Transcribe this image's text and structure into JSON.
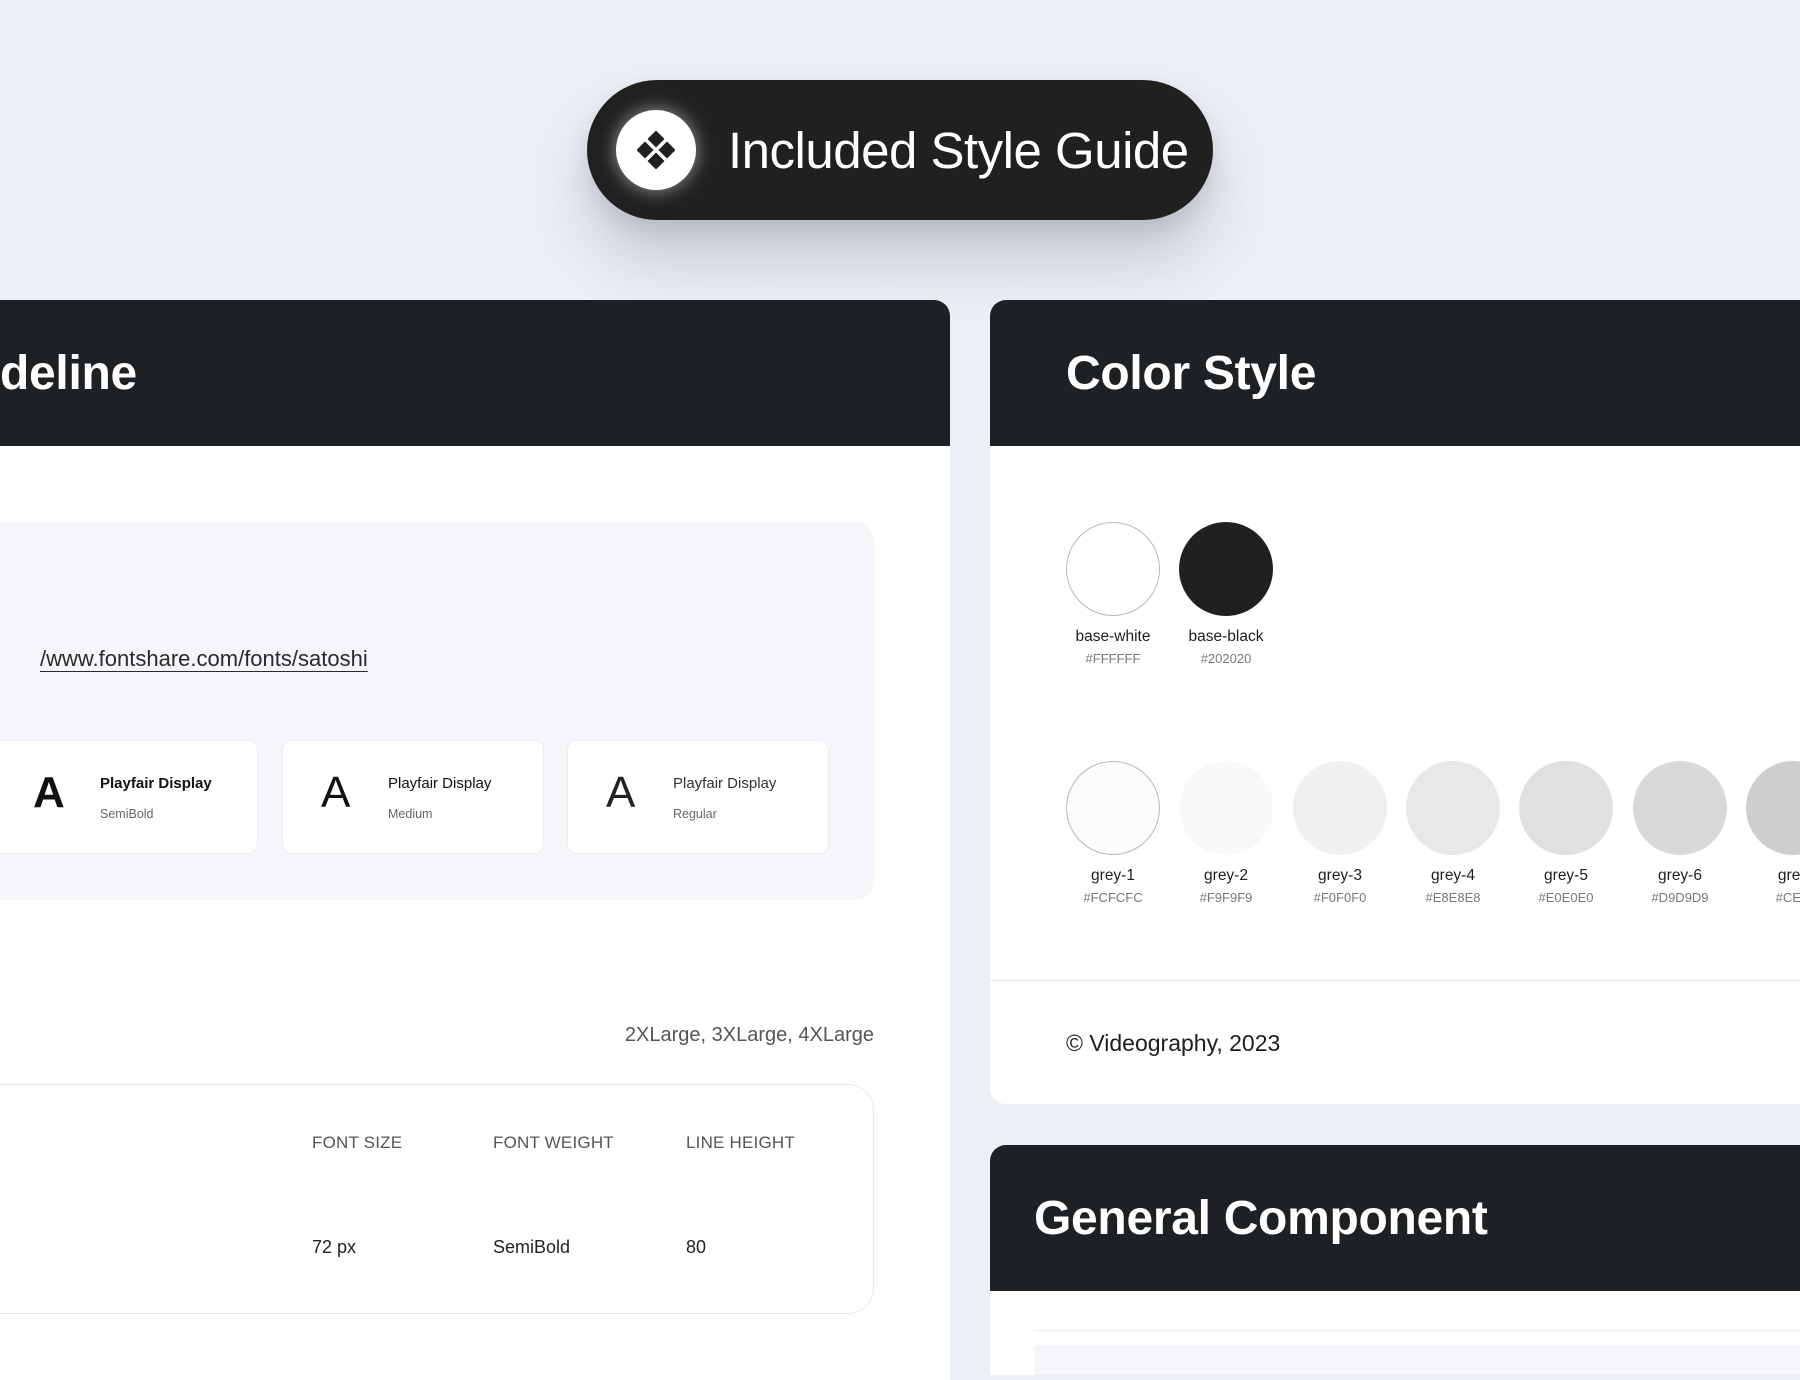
{
  "badge": {
    "title": "Included Style Guide",
    "icon": "diamond-grid-icon"
  },
  "typography": {
    "header_title": "deline",
    "font_link": "/www.fontshare.com/fonts/satoshi",
    "font_cards": [
      {
        "glyph": "A",
        "family": "Playfair Display",
        "weight": "SemiBold"
      },
      {
        "glyph": "A",
        "family": "Playfair Display",
        "weight": "Medium"
      },
      {
        "glyph": "A",
        "family": "Playfair Display",
        "weight": "Regular"
      }
    ],
    "sizes_note": "2XLarge, 3XLarge, 4XLarge",
    "table": {
      "headers": [
        "FONT SIZE",
        "FONT WEIGHT",
        "LINE HEIGHT"
      ],
      "row": [
        "72 px",
        "SemiBold",
        "80"
      ]
    }
  },
  "color_style": {
    "header_title": "Color Style",
    "base_colors": [
      {
        "name": "base-white",
        "hex": "#FFFFFF",
        "color": "#FFFFFF"
      },
      {
        "name": "base-black",
        "hex": "#202020",
        "color": "#202020"
      }
    ],
    "grey_colors": [
      {
        "name": "grey-1",
        "hex": "#FCFCFC",
        "color": "#FCFCFC"
      },
      {
        "name": "grey-2",
        "hex": "#F9F9F9",
        "color": "#F9F9F9"
      },
      {
        "name": "grey-3",
        "hex": "#F0F0F0",
        "color": "#F0F0F0"
      },
      {
        "name": "grey-4",
        "hex": "#E8E8E8",
        "color": "#E8E8E8"
      },
      {
        "name": "grey-5",
        "hex": "#E0E0E0",
        "color": "#E0E0E0"
      },
      {
        "name": "grey-6",
        "hex": "#D9D9D9",
        "color": "#D9D9D9"
      },
      {
        "name": "grey",
        "hex": "#CEC",
        "color": "#CECECE"
      }
    ],
    "copyright": "© Videography, 2023"
  },
  "general_component": {
    "header_title": "General Component"
  },
  "colors": {
    "background": "#ECEFF5",
    "header_dark": "#1E2124",
    "pill": "#202020",
    "panel": "#FFFFFF",
    "font_box": "#F4F6FA"
  }
}
